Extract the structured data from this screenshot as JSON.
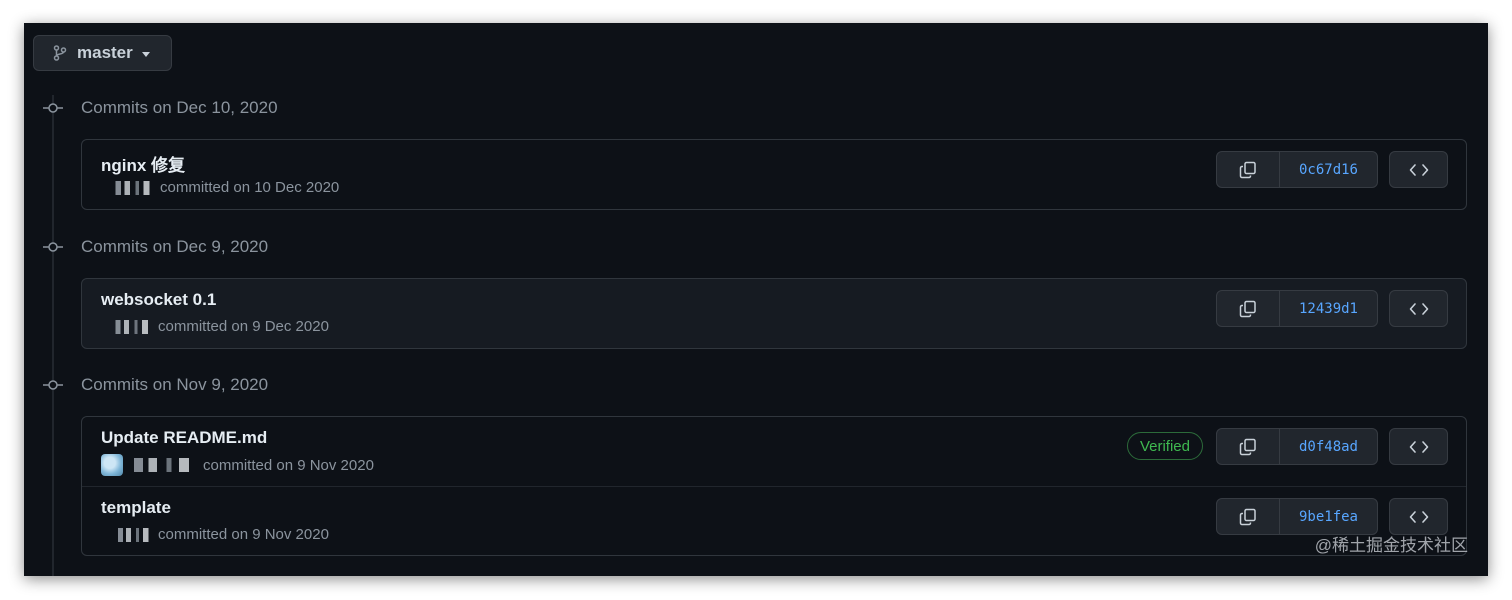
{
  "branch": {
    "label": "master",
    "icon": "git-branch-icon"
  },
  "groups": [
    {
      "title": "Commits on Dec 10, 2020",
      "commits": [
        {
          "title": "nginx 修复",
          "meta": "committed on 10 Dec 2020",
          "sha": "0c67d16",
          "verified": ""
        }
      ]
    },
    {
      "title": "Commits on Dec 9, 2020",
      "commits": [
        {
          "title": "websocket 0.1",
          "meta": "committed on 9 Dec 2020",
          "sha": "12439d1",
          "verified": ""
        }
      ]
    },
    {
      "title": "Commits on Nov 9, 2020",
      "commits": [
        {
          "title": "Update README.md",
          "meta": "committed on 9 Nov 2020",
          "sha": "d0f48ad",
          "verified": "Verified"
        },
        {
          "title": "template",
          "meta": "committed on 9 Nov 2020",
          "sha": "9be1fea",
          "verified": ""
        }
      ]
    }
  ],
  "icons": {
    "copy": "copy-icon",
    "browse": "code-icon",
    "node": "git-commit-icon"
  },
  "colors": {
    "background": "#0d1117",
    "sha_link": "#58a6ff",
    "verified": "#3fb950"
  },
  "watermark": "@稀土掘金技术社区"
}
